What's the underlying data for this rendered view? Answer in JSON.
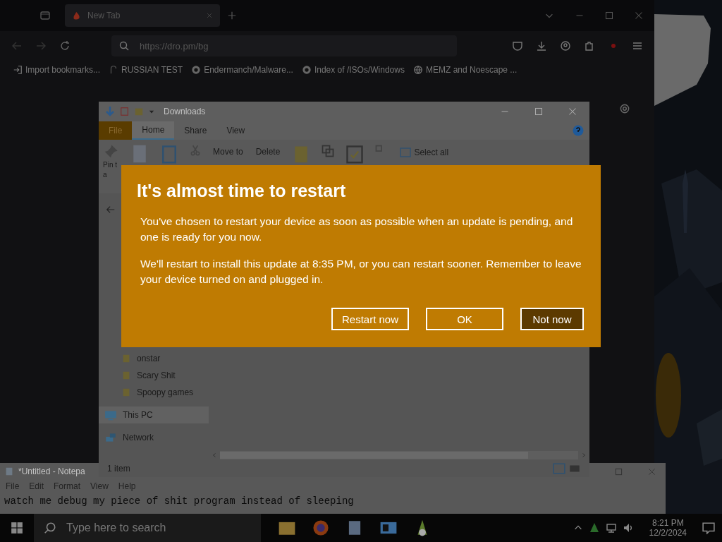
{
  "browser": {
    "tab": {
      "title": "New Tab"
    },
    "url": "https://dro.pm/bg",
    "bookmarks": [
      {
        "label": "Import bookmarks..."
      },
      {
        "label": "RUSSIAN TEST"
      },
      {
        "label": "Endermanch/Malware..."
      },
      {
        "label": "Index of /ISOs/Windows"
      },
      {
        "label": "MEMZ and Noescape ..."
      }
    ]
  },
  "explorer": {
    "title": "Downloads",
    "ribbon_tabs": [
      {
        "label": "File",
        "selected": false
      },
      {
        "label": "Home",
        "selected": true
      },
      {
        "label": "Share",
        "selected": false
      },
      {
        "label": "View",
        "selected": false
      }
    ],
    "pin_label": [
      "Pin t",
      "a"
    ],
    "ribbon_buttons": [
      {
        "label": "Move to"
      },
      {
        "label": "Delete"
      },
      {
        "label": "Select all"
      }
    ],
    "nav_items": [
      {
        "label": "onstar",
        "kind": "folder",
        "selected": false
      },
      {
        "label": "Scary Shit",
        "kind": "folder",
        "selected": false
      },
      {
        "label": "Spoopy games",
        "kind": "folder",
        "selected": false
      },
      {
        "label": "This PC",
        "kind": "pc",
        "selected": true
      },
      {
        "label": "Network",
        "kind": "network",
        "selected": false
      }
    ],
    "status": "1 item"
  },
  "notepad": {
    "title": "*Untitled - Notepa",
    "menu": [
      "File",
      "Edit",
      "Format",
      "View",
      "Help"
    ],
    "text": "watch me debug my piece of shit program instead of sleeping"
  },
  "dialog": {
    "title": "It's almost time to restart",
    "paragraphs": [
      "You've chosen to restart your device as soon as possible when an update is pending, and one is ready for you now.",
      "We'll restart to install this update at 8:35 PM, or you can restart sooner. Remember to leave your device turned on and plugged in."
    ],
    "buttons": [
      {
        "label": "Restart now",
        "kind": "secondary"
      },
      {
        "label": "OK",
        "kind": "secondary"
      },
      {
        "label": "Not now",
        "kind": "primary"
      }
    ]
  },
  "taskbar": {
    "search": {
      "placeholder": "Type here to search"
    },
    "time": "8:21 PM",
    "date": "12/2/2024"
  }
}
